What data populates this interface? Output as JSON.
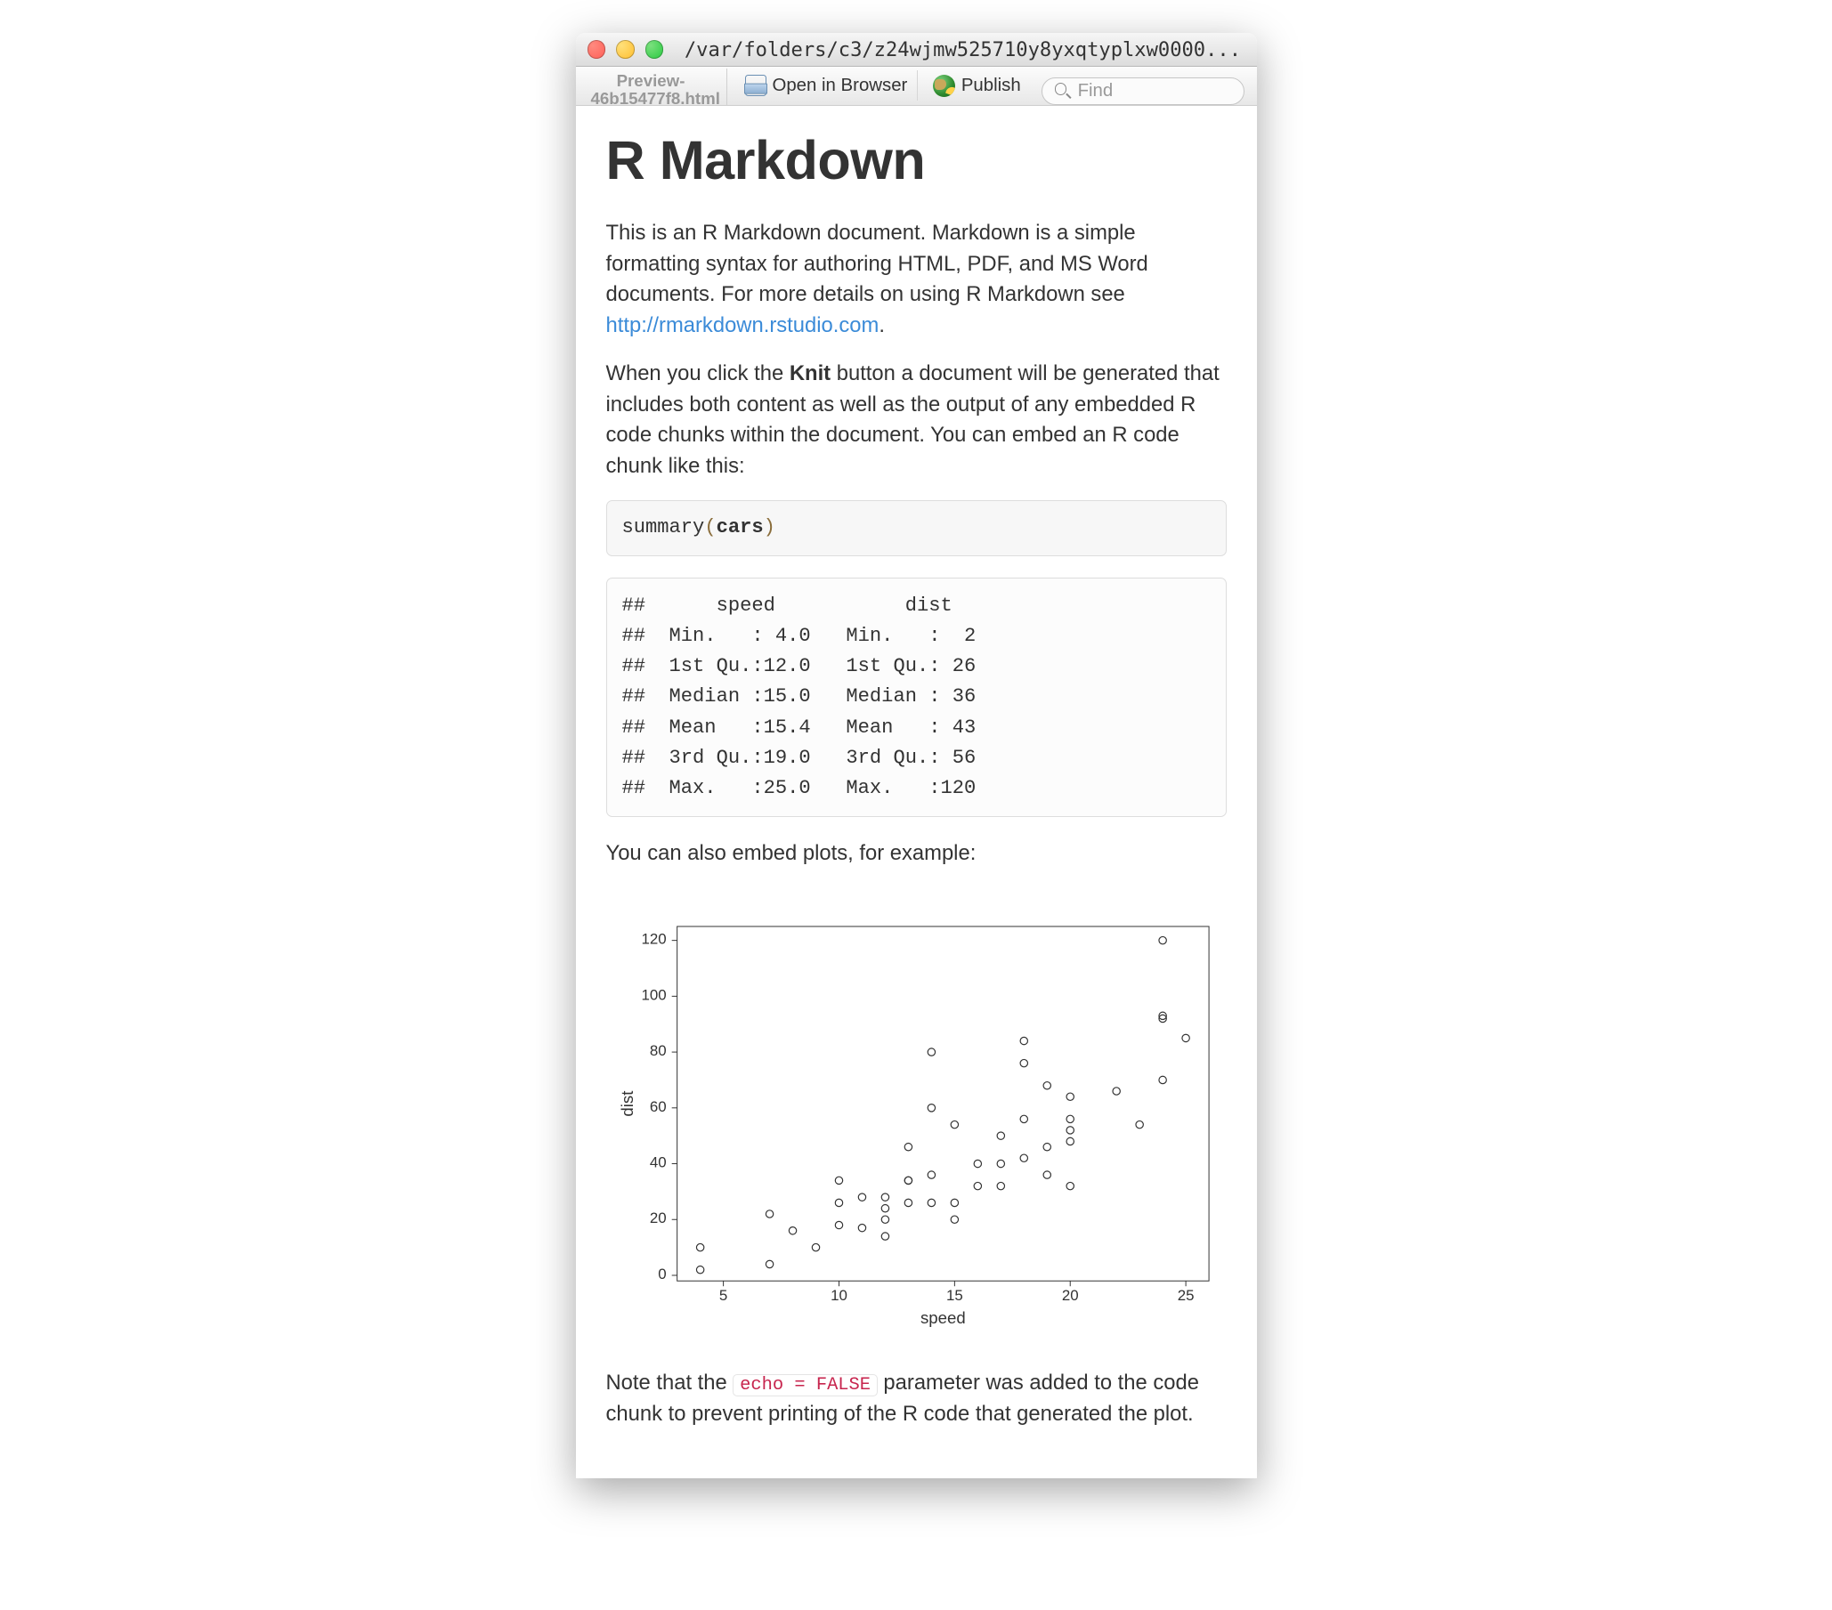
{
  "titlebar": {
    "path": "/var/folders/c3/z24wjmw525710y8yxqtyplxw0000..."
  },
  "toolbar": {
    "filetab": "Preview-46b15477f8.html",
    "open_in_browser": "Open in Browser",
    "publish": "Publish",
    "find_placeholder": "Find"
  },
  "doc": {
    "h1": "R Markdown",
    "p1_a": "This is an R Markdown document. Markdown is a simple formatting syntax for authoring HTML, PDF, and MS Word documents. For more details on using R Markdown see ",
    "p1_link": "http://rmarkdown.rstudio.com",
    "p1_b": ".",
    "p2_a": "When you click the ",
    "p2_bold": "Knit",
    "p2_b": " button a document will be generated that includes both content as well as the output of any embedded R code chunks within the document. You can embed an R code chunk like this:",
    "code_fn": "summary",
    "code_par_open": "(",
    "code_id": "cars",
    "code_par_close": ")",
    "output": "##      speed           dist    \n##  Min.   : 4.0   Min.   :  2  \n##  1st Qu.:12.0   1st Qu.: 26  \n##  Median :15.0   Median : 36  \n##  Mean   :15.4   Mean   : 43  \n##  3rd Qu.:19.0   3rd Qu.: 56  \n##  Max.   :25.0   Max.   :120  ",
    "p3": "You can also embed plots, for example:",
    "p4_a": "Note that the ",
    "p4_code": "echo = FALSE",
    "p4_b": " parameter was added to the code chunk to prevent printing of the R code that generated the plot."
  },
  "chart_data": {
    "type": "scatter",
    "xlabel": "speed",
    "ylabel": "dist",
    "xlim": [
      3,
      26
    ],
    "ylim": [
      -2,
      125
    ],
    "xticks": [
      5,
      10,
      15,
      20,
      25
    ],
    "yticks": [
      0,
      20,
      40,
      60,
      80,
      100,
      120
    ],
    "x": [
      4,
      4,
      7,
      7,
      8,
      9,
      10,
      10,
      10,
      11,
      11,
      12,
      12,
      12,
      12,
      13,
      13,
      13,
      13,
      14,
      14,
      14,
      14,
      15,
      15,
      15,
      16,
      16,
      17,
      17,
      17,
      18,
      18,
      18,
      18,
      19,
      19,
      19,
      20,
      20,
      20,
      20,
      20,
      22,
      23,
      24,
      24,
      24,
      24,
      25
    ],
    "y": [
      2,
      10,
      4,
      22,
      16,
      10,
      18,
      26,
      34,
      17,
      28,
      14,
      20,
      24,
      28,
      26,
      34,
      34,
      46,
      26,
      36,
      60,
      80,
      20,
      26,
      54,
      32,
      40,
      32,
      40,
      50,
      42,
      56,
      76,
      84,
      36,
      46,
      68,
      32,
      48,
      52,
      56,
      64,
      66,
      54,
      70,
      92,
      93,
      120,
      85
    ]
  }
}
